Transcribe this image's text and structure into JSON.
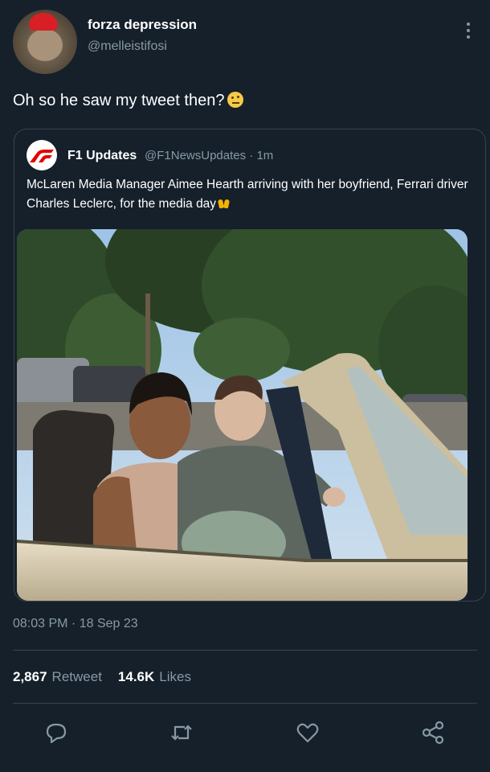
{
  "author": {
    "display_name": "forza depression",
    "handle": "@melleistifosi"
  },
  "tweet": {
    "text": "Oh so he saw my tweet then?",
    "emoji_icon": "face-with-raised-eyebrow-icon"
  },
  "quoted_tweet": {
    "name": "F1 Updates",
    "meta": "@F1NewsUpdates · 1m",
    "text": "McLaren Media Manager Aimee Hearth arriving with her boyfriend, Ferrari driver Charles Leclerc, for the media day",
    "emoji_icon": "raising-hands-icon",
    "avatar_icon": "f1-logo-icon"
  },
  "timestamp": "08:03 PM · 18 Sep 23",
  "stats": {
    "retweets_count": "2,867",
    "retweets_label": "Retweet",
    "likes_count": "14.6K",
    "likes_label": "Likes"
  },
  "actions": [
    "reply-icon",
    "retweet-icon",
    "like-icon",
    "share-icon"
  ],
  "colors": {
    "background": "#15202b",
    "secondary_text": "#8899a6",
    "border": "#38444d",
    "f1_red": "#e10600"
  }
}
